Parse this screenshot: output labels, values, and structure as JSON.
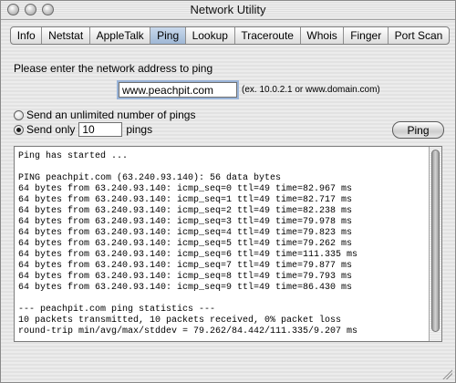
{
  "window": {
    "title": "Network Utility"
  },
  "tabs": [
    {
      "label": "Info"
    },
    {
      "label": "Netstat"
    },
    {
      "label": "AppleTalk"
    },
    {
      "label": "Ping",
      "active": true
    },
    {
      "label": "Lookup"
    },
    {
      "label": "Traceroute"
    },
    {
      "label": "Whois"
    },
    {
      "label": "Finger"
    },
    {
      "label": "Port Scan"
    }
  ],
  "ping": {
    "prompt": "Please enter the network address to ping",
    "address_value": "www.peachpit.com",
    "address_hint": "(ex. 10.0.2.1 or www.domain.com)",
    "unlimited_label": "Send an unlimited number of pings",
    "send_only_label": "Send only",
    "count_value": "10",
    "count_suffix": "pings",
    "selected_option": "send_only",
    "button_label": "Ping"
  },
  "output": {
    "lines": [
      "Ping has started ...",
      "",
      "PING peachpit.com (63.240.93.140): 56 data bytes",
      "64 bytes from 63.240.93.140: icmp_seq=0 ttl=49 time=82.967 ms",
      "64 bytes from 63.240.93.140: icmp_seq=1 ttl=49 time=82.717 ms",
      "64 bytes from 63.240.93.140: icmp_seq=2 ttl=49 time=82.238 ms",
      "64 bytes from 63.240.93.140: icmp_seq=3 ttl=49 time=79.978 ms",
      "64 bytes from 63.240.93.140: icmp_seq=4 ttl=49 time=79.823 ms",
      "64 bytes from 63.240.93.140: icmp_seq=5 ttl=49 time=79.262 ms",
      "64 bytes from 63.240.93.140: icmp_seq=6 ttl=49 time=111.335 ms",
      "64 bytes from 63.240.93.140: icmp_seq=7 ttl=49 time=79.877 ms",
      "64 bytes from 63.240.93.140: icmp_seq=8 ttl=49 time=79.793 ms",
      "64 bytes from 63.240.93.140: icmp_seq=9 ttl=49 time=86.430 ms",
      "",
      "--- peachpit.com ping statistics ---",
      "10 packets transmitted, 10 packets received, 0% packet loss",
      "round-trip min/avg/max/stddev = 79.262/84.442/111.335/9.207 ms"
    ]
  }
}
